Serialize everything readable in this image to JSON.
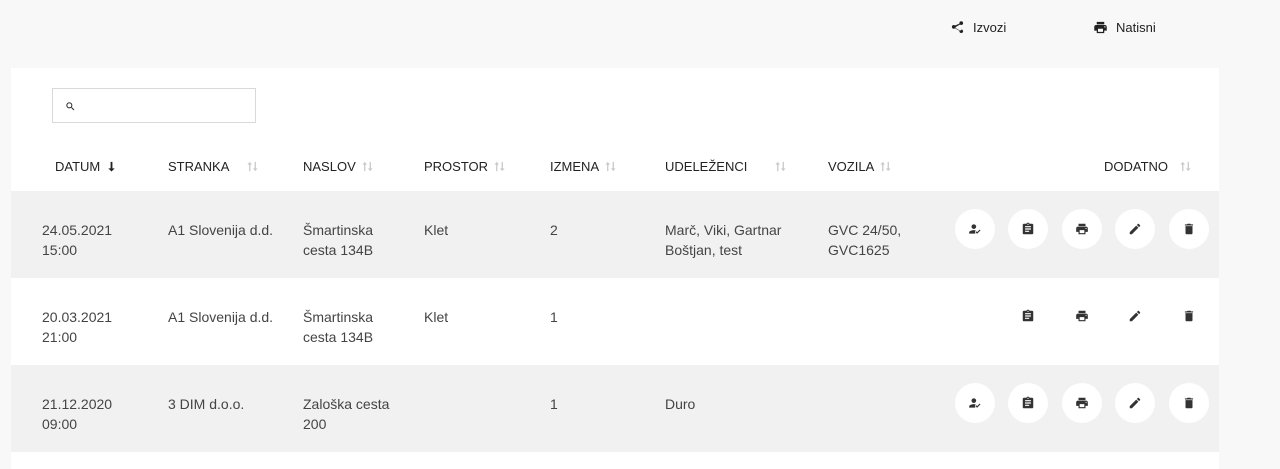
{
  "toolbar": {
    "export_label": "Izvozi",
    "print_label": "Natisni",
    "export_icon": "share-icon",
    "print_icon": "printer-icon"
  },
  "search": {
    "placeholder": "",
    "value": "",
    "icon": "search-icon"
  },
  "table": {
    "columns": [
      {
        "label": "DATUM",
        "sort": "descending"
      },
      {
        "label": "STRANKA",
        "sort": "none"
      },
      {
        "label": "NASLOV",
        "sort": "none"
      },
      {
        "label": "PROSTOR",
        "sort": "none"
      },
      {
        "label": "IZMENA",
        "sort": "none"
      },
      {
        "label": "UDELEŽENCI",
        "sort": "none"
      },
      {
        "label": "VOZILA",
        "sort": "none"
      },
      {
        "label": "DODATNO",
        "sort": "none"
      }
    ],
    "rows": [
      {
        "datum": [
          "24.05.2021",
          "15:00"
        ],
        "stranka": "A1 Slovenija d.d.",
        "naslov": [
          "Šmartinska",
          "cesta 134B"
        ],
        "prostor": "Klet",
        "izmena": "2",
        "udelezenci": [
          "Marč, Viki, Gartnar",
          "Boštjan, test"
        ],
        "vozila": [
          "GVC 24/50,",
          "GVC1625"
        ],
        "actions": [
          "sign-icon",
          "clipboard-icon",
          "printer-icon",
          "pencil-icon",
          "trash-icon"
        ]
      },
      {
        "datum": [
          "20.03.2021",
          "21:00"
        ],
        "stranka": "A1 Slovenija d.d.",
        "naslov": [
          "Šmartinska",
          "cesta 134B"
        ],
        "prostor": "Klet",
        "izmena": "1",
        "udelezenci": [
          "",
          ""
        ],
        "vozila": [
          "",
          ""
        ],
        "actions": [
          "clipboard-icon",
          "printer-icon",
          "pencil-icon",
          "trash-icon"
        ]
      },
      {
        "datum": [
          "21.12.2020",
          "09:00"
        ],
        "stranka": "3 DIM d.o.o.",
        "naslov": [
          "Zaloška cesta",
          "200"
        ],
        "prostor": "",
        "izmena": "1",
        "udelezenci": [
          "Duro",
          ""
        ],
        "vozila": [
          "",
          ""
        ],
        "actions": [
          "sign-icon",
          "clipboard-icon",
          "printer-icon",
          "pencil-icon",
          "trash-icon"
        ]
      }
    ]
  }
}
